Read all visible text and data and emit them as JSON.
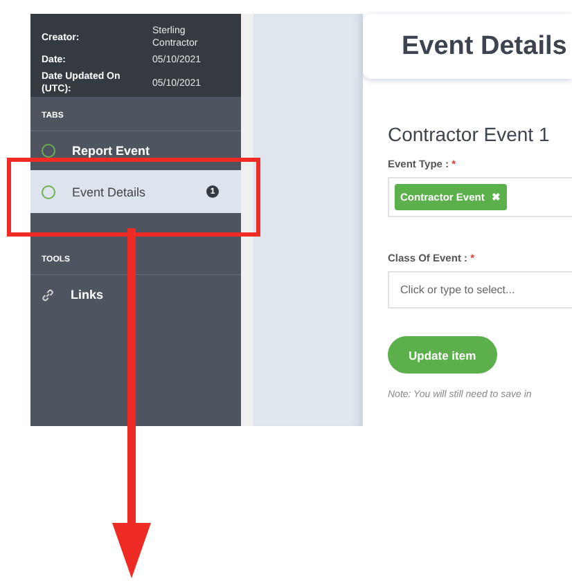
{
  "info": [
    {
      "label": "Creator:",
      "value": "Sterling Contractor"
    },
    {
      "label": "Date:",
      "value": "05/10/2021"
    },
    {
      "label": "Date Updated On (UTC):",
      "value": "05/10/2021"
    }
  ],
  "sections": [
    {
      "heading": "TABS",
      "items": [
        {
          "kind": "tab",
          "label": "Report Event",
          "selected": false
        },
        {
          "kind": "tab",
          "label": "Event Details",
          "selected": true,
          "badge": "1"
        }
      ]
    },
    {
      "heading": "TOOLS",
      "items": [
        {
          "kind": "link",
          "label": "Links",
          "selected": false
        }
      ]
    }
  ],
  "page_title": "Event Details",
  "form": {
    "title": "Contractor Event 1",
    "fields": [
      {
        "kind": "tags",
        "label": "Event Type :",
        "required": "*",
        "tags": [
          "Contractor Event"
        ],
        "remove": "✖"
      },
      {
        "kind": "select",
        "label": "Class Of Event :",
        "required": "*",
        "placeholder": "Click or type to select..."
      }
    ],
    "button": "Update item",
    "note": "Note: You will still need to save in"
  }
}
